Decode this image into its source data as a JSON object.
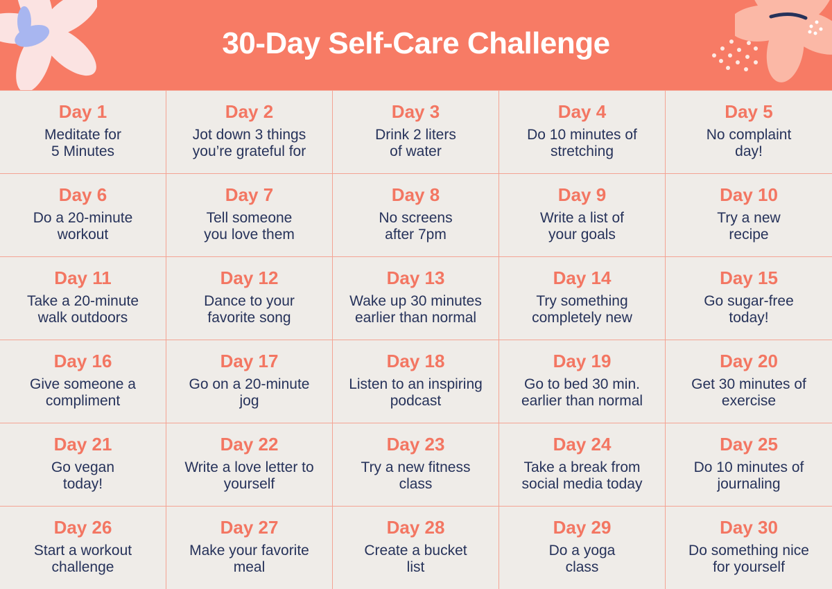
{
  "title": "30-Day Self-Care Challenge",
  "colors": {
    "header": "#f77b65",
    "day_label": "#f37662",
    "task_text": "#26325a",
    "cell_bg": "#efece8",
    "grid_line": "#f4a393"
  },
  "decorations": [
    "flower-icon",
    "flower-icon",
    "dots-icon"
  ],
  "days": [
    {
      "label": "Day 1",
      "task": "Meditate for\n5 Minutes"
    },
    {
      "label": "Day 2",
      "task": "Jot down 3 things\nyou’re grateful for"
    },
    {
      "label": "Day 3",
      "task": "Drink 2 liters\nof water"
    },
    {
      "label": "Day 4",
      "task": "Do 10 minutes of\nstretching"
    },
    {
      "label": "Day 5",
      "task": "No complaint\nday!"
    },
    {
      "label": "Day 6",
      "task": "Do a 20-minute\nworkout"
    },
    {
      "label": "Day 7",
      "task": "Tell someone\nyou love them"
    },
    {
      "label": "Day 8",
      "task": "No screens\nafter 7pm"
    },
    {
      "label": "Day 9",
      "task": "Write a list of\nyour goals"
    },
    {
      "label": "Day 10",
      "task": "Try a new\nrecipe"
    },
    {
      "label": "Day 11",
      "task": "Take a 20-minute\nwalk outdoors"
    },
    {
      "label": "Day 12",
      "task": "Dance to your\nfavorite song"
    },
    {
      "label": "Day 13",
      "task": "Wake up 30 minutes\nearlier than normal"
    },
    {
      "label": "Day 14",
      "task": "Try something\ncompletely new"
    },
    {
      "label": "Day 15",
      "task": "Go sugar-free\ntoday!"
    },
    {
      "label": "Day 16",
      "task": "Give someone a\ncompliment"
    },
    {
      "label": "Day 17",
      "task": "Go on a 20-minute\njog"
    },
    {
      "label": "Day 18",
      "task": "Listen to an inspiring\npodcast"
    },
    {
      "label": "Day 19",
      "task": "Go to bed 30 min.\nearlier than normal"
    },
    {
      "label": "Day 20",
      "task": "Get 30 minutes of\nexercise"
    },
    {
      "label": "Day 21",
      "task": "Go vegan\ntoday!"
    },
    {
      "label": "Day 22",
      "task": "Write a love letter to\nyourself"
    },
    {
      "label": "Day 23",
      "task": "Try a new fitness\nclass"
    },
    {
      "label": "Day 24",
      "task": "Take a break from\nsocial media today"
    },
    {
      "label": "Day 25",
      "task": "Do 10 minutes of\njournaling"
    },
    {
      "label": "Day 26",
      "task": "Start a workout\nchallenge"
    },
    {
      "label": "Day 27",
      "task": "Make your favorite\nmeal"
    },
    {
      "label": "Day 28",
      "task": "Create a bucket\nlist"
    },
    {
      "label": "Day 29",
      "task": "Do a yoga\nclass"
    },
    {
      "label": "Day 30",
      "task": "Do something nice\nfor yourself"
    }
  ]
}
